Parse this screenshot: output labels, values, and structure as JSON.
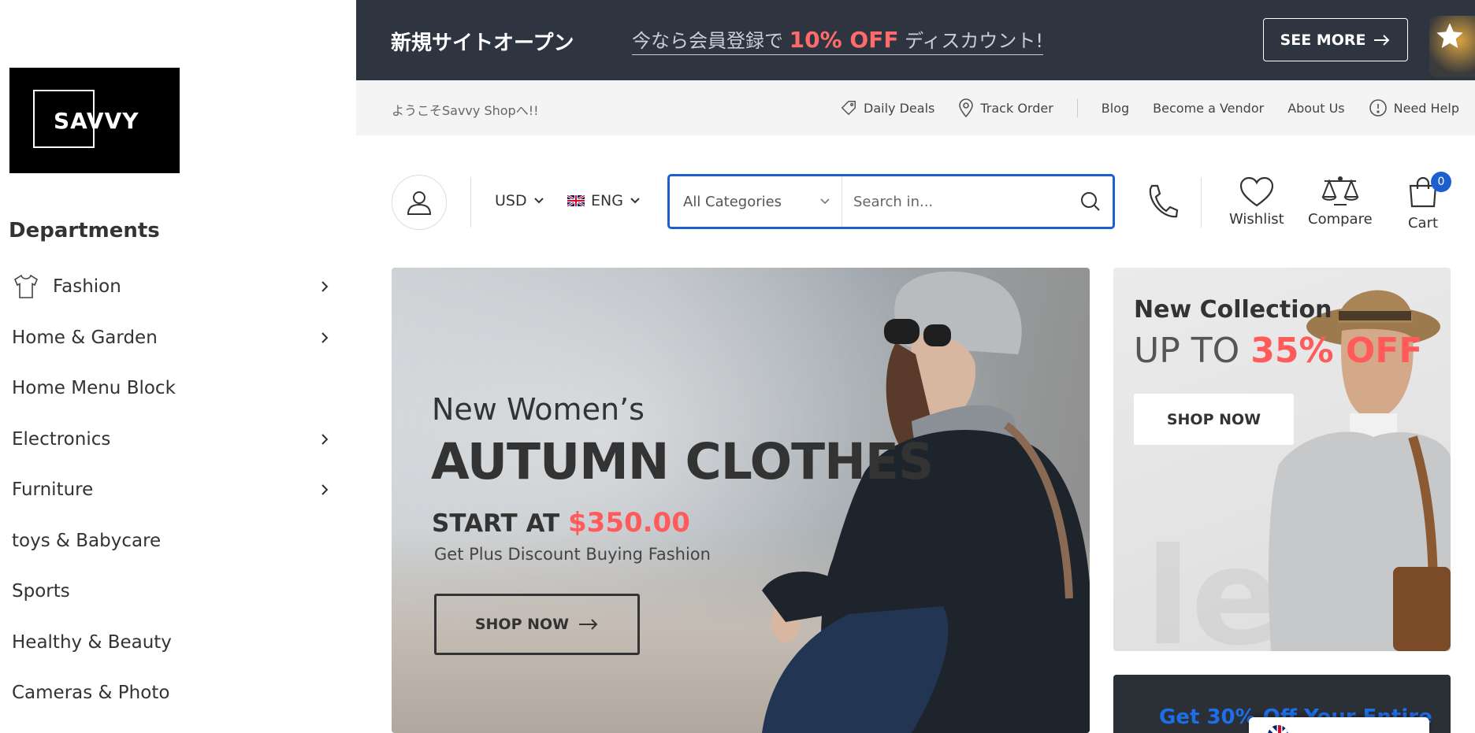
{
  "sidebar": {
    "logo_text": "SAVVY",
    "departments_title": "Departments",
    "items": [
      {
        "label": "Fashion",
        "has_submenu": true,
        "icon": "tshirt-icon"
      },
      {
        "label": "Home & Garden",
        "has_submenu": true
      },
      {
        "label": "Home Menu Block",
        "has_submenu": false
      },
      {
        "label": "Electronics",
        "has_submenu": true
      },
      {
        "label": "Furniture",
        "has_submenu": true
      },
      {
        "label": "toys & Babycare",
        "has_submenu": false
      },
      {
        "label": "Sports",
        "has_submenu": false
      },
      {
        "label": "Healthy & Beauty",
        "has_submenu": false
      },
      {
        "label": "Cameras & Photo",
        "has_submenu": false
      }
    ]
  },
  "promo": {
    "title": "新規サイトオープン",
    "message_prefix": "今なら会員登録で",
    "message_highlight": "10% OFF",
    "message_suffix": "ディスカウント!",
    "see_more_label": "SEE MORE",
    "highlight_color": "#ff6b6b"
  },
  "infobar": {
    "welcome": "ようこそSavvy Shopへ!!",
    "links": {
      "daily_deals": "Daily Deals",
      "track_order": "Track Order",
      "blog": "Blog",
      "become_vendor": "Become a Vendor",
      "about_us": "About Us",
      "need_help": "Need Help"
    }
  },
  "header": {
    "currency": "USD",
    "language": "ENG",
    "search": {
      "category": "All Categories",
      "placeholder": "Search in..."
    },
    "wishlist_label": "Wishlist",
    "compare_label": "Compare",
    "cart_label": "Cart",
    "cart_count": "0",
    "accent_color": "#1e5fd0"
  },
  "hero": {
    "subtitle": "New Women’s",
    "headline": "AUTUMN CLOTHES",
    "start_at_label": "START AT",
    "price": "$350.00",
    "description": "Get Plus Discount Buying Fashion",
    "shop_now_label": "SHOP NOW"
  },
  "side_banner": {
    "title": "New Collection",
    "up_to": "UP TO",
    "discount": "35% OFF",
    "shop_now_label": "SHOP NOW"
  },
  "dark_banner": {
    "text": "Get 30% Off Your Entire"
  }
}
